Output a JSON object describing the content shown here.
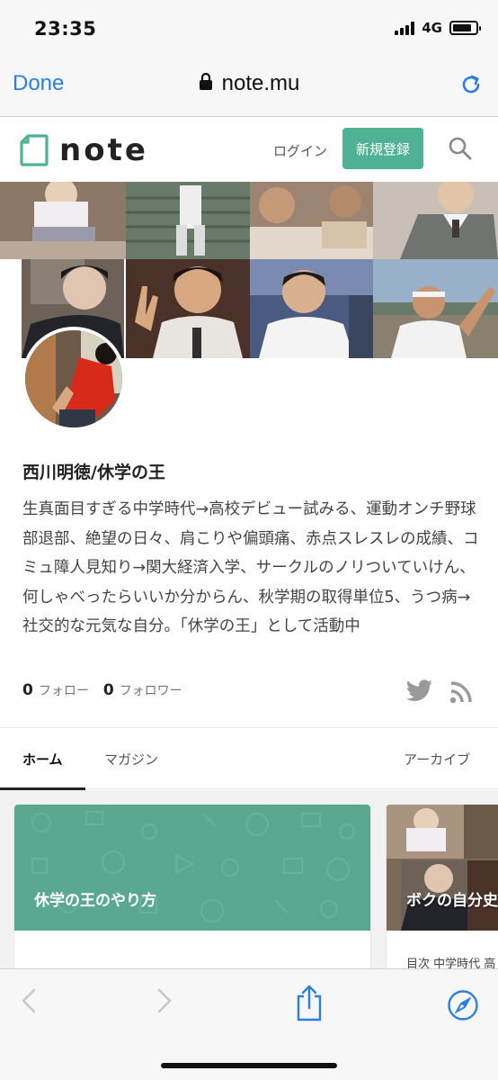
{
  "status": {
    "time": "23:35",
    "network": "4G",
    "battery_level": 0.85
  },
  "browser": {
    "done_label": "Done",
    "url": "note.mu"
  },
  "header": {
    "logo": "note",
    "login": "ログイン",
    "signup": "新規登録"
  },
  "profile": {
    "name": "西川明徳/休学の王",
    "bio": "生真面目すぎる中学時代→高校デビュー試みる、運動オンチ野球部退部、絶望の日々、肩こりや偏頭痛、赤点スレスレの成績、コミュ障人見知り→関大経済入学、サークルのノリついていけん、何しゃべったらいいか分からん、秋学期の取得単位5、うつ病→社交的な元気な自分。「休学の王」として活動中",
    "follow_count": "0",
    "follow_label": "フォロー",
    "follower_count": "0",
    "follower_label": "フォロワー"
  },
  "tabs": [
    {
      "label": "ホーム",
      "active": true
    },
    {
      "label": "マガジン",
      "active": false
    },
    {
      "label": "アーカイブ",
      "active": false
    }
  ],
  "cards": [
    {
      "title": "休学の王のやり方"
    },
    {
      "title": "ボクの自分史",
      "meta": "目次 中学時代 高"
    }
  ],
  "colors": {
    "brand": "#4fb295",
    "link": "#2a7fe0"
  }
}
